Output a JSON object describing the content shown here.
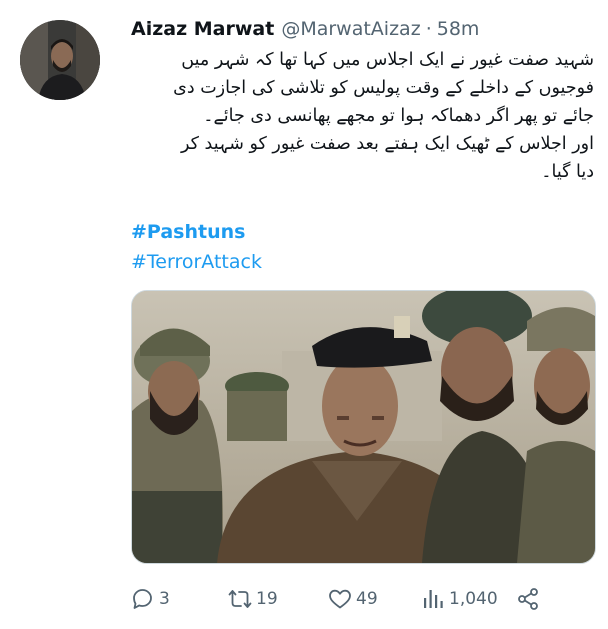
{
  "tweet": {
    "author_name": "Aizaz Marwat",
    "handle": "@MarwatAizaz",
    "separator": "·",
    "time": "58m",
    "text_lines": [
      "شہید صفت غیور نے ایک اجلاس میں کہا تھا کہ شہر میں",
      "فوجیوں کے داخلے کے وقت پولیس کو تلاشی کی اجازت دی",
      "جائے تو پھر اگر دھماکہ ہوا تو مجھے پھانسی دی جائے۔",
      "اور اجلاس کے ٹھیک ایک ہفتے بعد صفت غیور کو شہید کر",
      "دیا گیا۔"
    ],
    "hashtags": [
      "#Pashtuns",
      "#TerrorAttack"
    ]
  },
  "actions": {
    "reply": {
      "icon": "reply-icon",
      "count": "3"
    },
    "retweet": {
      "icon": "retweet-icon",
      "count": "19"
    },
    "like": {
      "icon": "heart-icon",
      "count": "49"
    },
    "views": {
      "icon": "views-bar-chart-icon",
      "count": "1,040"
    },
    "share": {
      "icon": "share-icon"
    }
  },
  "colors": {
    "link": "#1d9bf0",
    "secondary_text": "#536471",
    "primary_text": "#0f1419"
  }
}
